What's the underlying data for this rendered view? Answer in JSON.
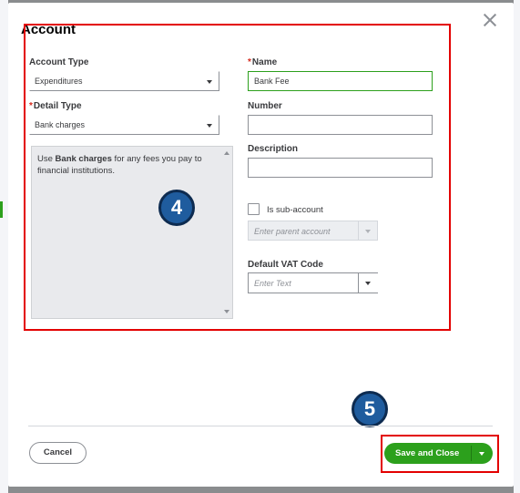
{
  "dialog": {
    "title": "Account"
  },
  "form": {
    "account_type": {
      "label": "Account Type",
      "value": "Expenditures"
    },
    "detail_type": {
      "label": "Detail Type",
      "value": "Bank charges",
      "required": "*"
    },
    "name": {
      "label": "Name",
      "value": "Bank Fee",
      "required": "*"
    },
    "number": {
      "label": "Number",
      "value": ""
    },
    "description": {
      "label": "Description",
      "value": ""
    },
    "sub_account": {
      "label": "Is sub-account",
      "placeholder": "Enter parent account"
    },
    "vat": {
      "label": "Default VAT Code",
      "placeholder": "Enter Text"
    }
  },
  "help": {
    "prefix": "Use ",
    "bold": "Bank charges",
    "suffix": " for any fees you pay to financial institutions."
  },
  "footer": {
    "cancel_label": "Cancel",
    "save_label": "Save and Close"
  },
  "annotations": {
    "step_4": "4",
    "step_5": "5"
  },
  "colors": {
    "accent_green": "#2ca01c",
    "highlight_red": "#e30000",
    "badge_blue": "#1f5c9e",
    "overlay_gray": "#8a8c8e"
  },
  "icons": [
    "close-icon",
    "chevron-down-icon",
    "checkbox-icon",
    "scroll-up-icon",
    "scroll-down-icon"
  ]
}
